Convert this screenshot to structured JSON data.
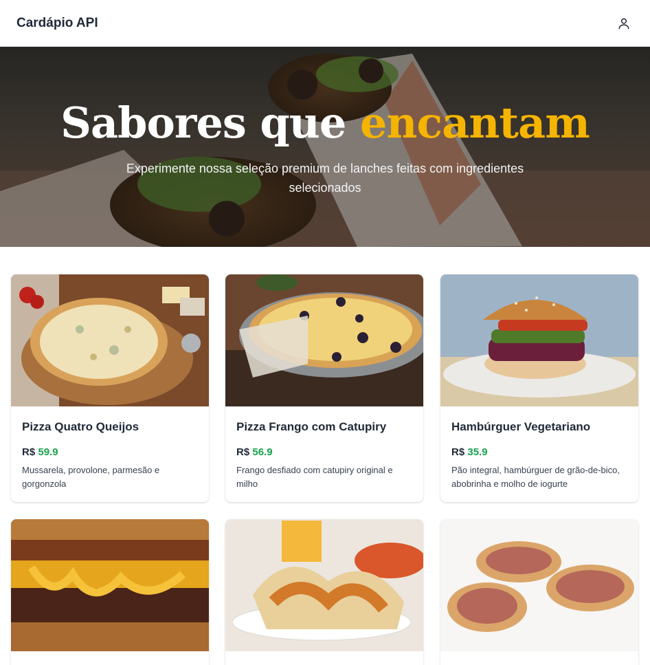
{
  "app": {
    "brand": "Cardápio API",
    "user_icon": "user-icon"
  },
  "hero": {
    "title_main": "Sabores que",
    "title_accent": "encantam",
    "subtitle": "Experimente nossa seleção premium de lanches feitas com ingredientes selecionados",
    "accent_color": "#f5b400"
  },
  "products": [
    {
      "name": "Pizza Quatro Queijos",
      "currency": "R$",
      "price": "59.9",
      "description": "Mussarela, provolone, parmesão e gorgonzola"
    },
    {
      "name": "Pizza Frango com Catupiry",
      "currency": "R$",
      "price": "56.9",
      "description": "Frango desfiado com catupiry original e milho"
    },
    {
      "name": "Hambúrguer Vegetariano",
      "currency": "R$",
      "price": "35.9",
      "description": "Pão integral, hambúrguer de grão-de-bico, abobrinha e molho de iogurte"
    }
  ],
  "price_color": "#16a34a"
}
